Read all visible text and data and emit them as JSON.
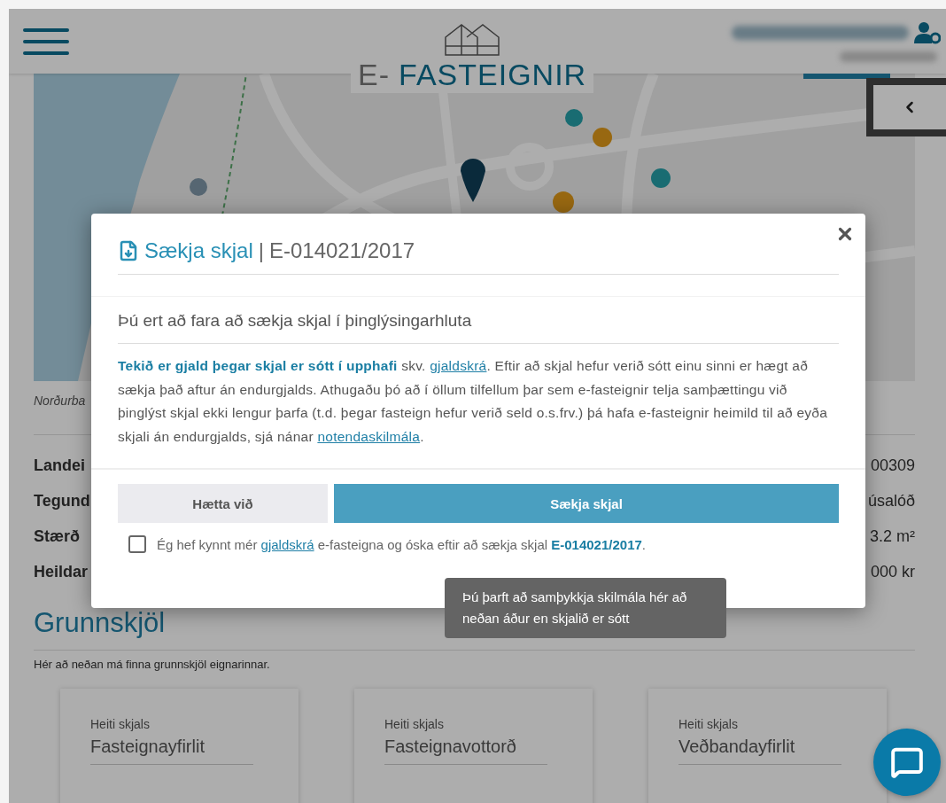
{
  "header": {
    "logo": {
      "prefix": "E-",
      "name": "FASTEIGNIR"
    }
  },
  "map_caption": "Norðurba",
  "property_rows": [
    {
      "label": "Landei",
      "value": "00309"
    },
    {
      "label": "Tegund",
      "value": "úsalóð"
    },
    {
      "label": "Stærð",
      "value": "3.2 m²"
    },
    {
      "label": "Heildar",
      "value": "000 kr"
    }
  ],
  "documents": {
    "title": "Grunnskjöl",
    "intro": "Hér að neðan má finna grunnskjöl eignarinnar.",
    "cards": [
      {
        "label": "Heiti skjals",
        "value": "Fasteignayfirlit"
      },
      {
        "label": "Heiti skjals",
        "value": "Fasteignavottorð"
      },
      {
        "label": "Heiti skjals",
        "value": "Veðbandayfirlit"
      }
    ]
  },
  "modal": {
    "title": "Sækja skjal",
    "separator": "|",
    "reference": "E-014021/2017",
    "subtitle": "Þú ert að fara að sækja skjal í þinglýsingarhluta",
    "body": [
      {
        "kind": "bold",
        "text": "Tekið er gjald þegar skjal er sótt í upphafi"
      },
      {
        "kind": "text",
        "text": " skv. "
      },
      {
        "kind": "link",
        "text": "gjaldskrá"
      },
      {
        "kind": "text",
        "text": ". Eftir að skjal hefur verið sótt einu sinni er hægt að sækja það aftur án endurgjalds. Athugaðu þó að í öllum tilfellum þar sem e-fasteignir telja samþættingu við þinglýst skjal ekki lengur þarfa (t.d. þegar fasteign hefur verið seld o.s.frv.) þá hafa e-fasteignir heimild til að eyða skjali án endurgjalds, sjá nánar "
      },
      {
        "kind": "link",
        "text": "notendaskilmála"
      },
      {
        "kind": "text",
        "text": "."
      }
    ],
    "buttons": [
      {
        "kind": "secondary",
        "label": "Hætta við"
      },
      {
        "kind": "primary",
        "label": "Sækja skjal"
      }
    ],
    "consent": {
      "checked": false,
      "parts": [
        {
          "kind": "text",
          "text": "Ég hef kynnt mér "
        },
        {
          "kind": "link",
          "text": "gjaldskrá"
        },
        {
          "kind": "text",
          "text": " e-fasteigna og óska eftir að sækja skjal "
        },
        {
          "kind": "bold",
          "text": "E-014021/2017"
        },
        {
          "kind": "text",
          "text": "."
        }
      ]
    },
    "tooltip": "Þú þarft að samþykkja skilmála hér að neðan áður en skjalið er sótt"
  }
}
